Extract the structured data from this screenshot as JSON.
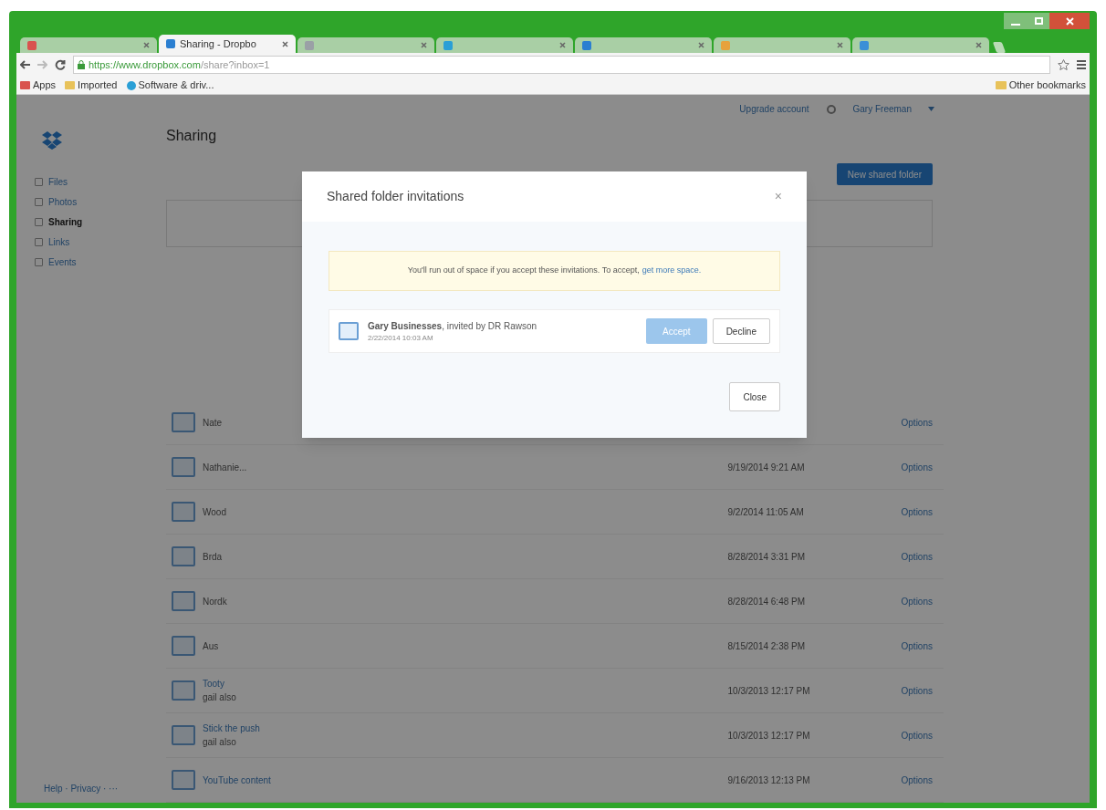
{
  "browser": {
    "tabs": [
      {
        "selected": false
      },
      {
        "label": "Sharing - Dropbo",
        "selected": true
      },
      {
        "selected": false
      },
      {
        "selected": false
      },
      {
        "selected": false
      },
      {
        "selected": false
      },
      {
        "selected": false
      }
    ],
    "url_host": "https://www.dropbox.com",
    "url_path": "/share?inbox=1",
    "bookmarks": [
      {
        "label": "Apps",
        "kind": "apps"
      },
      {
        "label": "Imported",
        "kind": "folder"
      },
      {
        "label": "Software & driv...",
        "kind": "site"
      }
    ],
    "other_bookmarks": "Other bookmarks"
  },
  "header": {
    "upgrade": "Upgrade account",
    "user": "Gary Freeman"
  },
  "sidebar": {
    "items": [
      {
        "label": "Files",
        "selected": false
      },
      {
        "label": "Photos",
        "selected": false
      },
      {
        "label": "Sharing",
        "selected": true
      },
      {
        "label": "Links",
        "selected": false
      },
      {
        "label": "Events",
        "selected": false
      }
    ],
    "footer": "Help · Privacy · ···"
  },
  "page": {
    "title": "Sharing",
    "new_folder_button": "New shared folder"
  },
  "rows": [
    {
      "owner": "Nate",
      "action": "Options"
    },
    {
      "owner": "Nathanie...",
      "date": "9/19/2014 9:21 AM",
      "action": "Options"
    },
    {
      "owner": "Wood",
      "date": "9/2/2014 11:05 AM",
      "action": "Options"
    },
    {
      "owner": "Brda",
      "date": "8/28/2014 3:31 PM",
      "action": "Options"
    },
    {
      "owner": "Nordk",
      "date": "8/28/2014 6:48 PM",
      "action": "Options"
    },
    {
      "owner": "Aus",
      "date": "8/15/2014 2:38 PM",
      "action": "Options"
    },
    {
      "name": "Tooty",
      "owner": "gail also",
      "date": "10/3/2013 12:17 PM",
      "action": "Options"
    },
    {
      "name": "Stick the push",
      "owner": "gail also",
      "date": "10/3/2013 12:17 PM",
      "action": "Options"
    },
    {
      "name": "YouTube content",
      "date": "9/16/2013 12:13 PM",
      "action": "Options"
    }
  ],
  "dialog": {
    "title": "Shared folder invitations",
    "close_glyph": "×",
    "warning": "You'll run out of space if you accept these invitations. To accept,",
    "warning_link": "get more space.",
    "invitations": [
      {
        "text": "**Gary Businesses**, invited by DR Rawson",
        "date": "2/22/2014 10:03 AM",
        "accept": "Accept",
        "decline": "Decline",
        "accept_disabled": true
      }
    ],
    "close_button": "Close"
  }
}
